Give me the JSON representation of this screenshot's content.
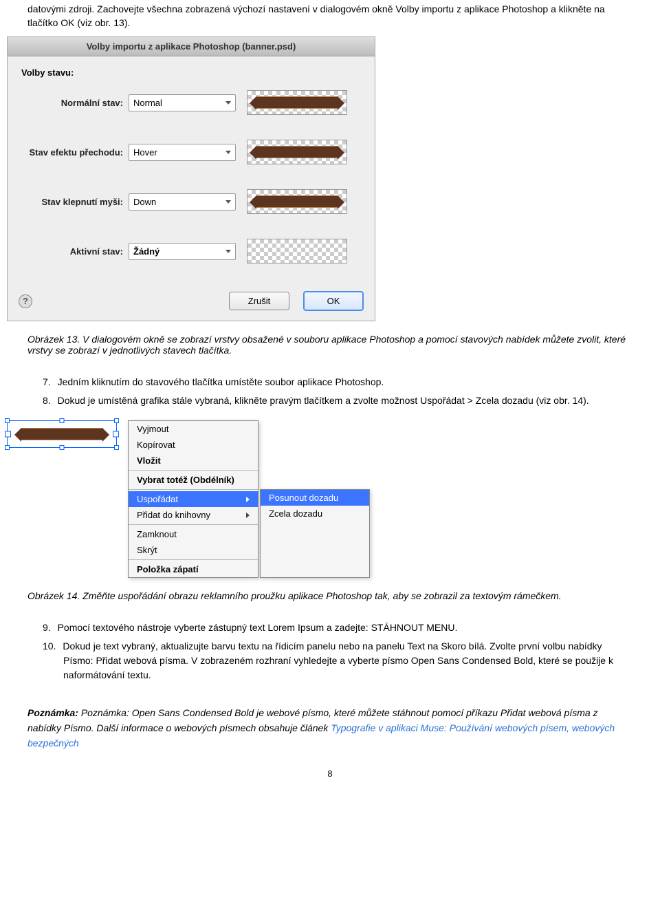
{
  "intro": "datovými zdroji. Zachovejte všechna zobrazená výchozí nastavení v dialogovém okně Volby importu z aplikace Photoshop a klikněte na tlačítko OK (viz obr. 13).",
  "dialog": {
    "title": "Volby importu z aplikace Photoshop (banner.psd)",
    "section": "Volby stavu:",
    "rows": {
      "normal": {
        "label": "Normální stav:",
        "value": "Normal"
      },
      "hover": {
        "label": "Stav efektu přechodu:",
        "value": "Hover"
      },
      "down": {
        "label": "Stav klepnutí myši:",
        "value": "Down"
      },
      "active": {
        "label": "Aktivní stav:",
        "value": "Žádný"
      }
    },
    "cancel": "Zrušit",
    "ok": "OK"
  },
  "caption13": "Obrázek 13. V dialogovém okně se zobrazí vrstvy obsažené v souboru aplikace Photoshop a pomocí stavových nabídek můžete zvolit, které vrstvy se zobrazí v jednotlivých stavech tlačítka.",
  "steps1": {
    "s7": "Jedním kliknutím do stavového tlačítka umístěte soubor aplikace Photoshop.",
    "s8": "Dokud je umístěná grafika stále vybraná, klikněte pravým tlačítkem a zvolte možnost Uspořádat > Zcela dozadu (viz obr. 14)."
  },
  "contextMenu": {
    "cut": "Vyjmout",
    "copy": "Kopírovat",
    "paste": "Vložit",
    "selectSame": "Vybrat totéž (Obdélník)",
    "arrange": "Uspořádat",
    "addLib": "Přidat do knihovny",
    "lock": "Zamknout",
    "hide": "Skrýt",
    "footerItem": "Položka zápatí",
    "sub": {
      "forward": "Posunout dozadu",
      "back": "Zcela dozadu"
    }
  },
  "caption14": "Obrázek 14. Změňte uspořádání obrazu reklamního proužku aplikace Photoshop tak, aby se zobrazil za textovým rámečkem.",
  "steps2": {
    "s9": "Pomocí textového nástroje vyberte zástupný text Lorem Ipsum a zadejte: STÁHNOUT MENU.",
    "s10": "Dokud je text vybraný, aktualizujte barvu textu na řídicím panelu nebo na panelu Text na Skoro bílá. Zvolte první volbu nabídky Písmo: Přidat webová písma. V zobrazeném rozhraní vyhledejte a vyberte písmo Open Sans Condensed Bold, které se použije k naformátování textu."
  },
  "note": {
    "prefix": "Poznámka:",
    "body1": " Poznámka: Open Sans Condensed Bold je webové písmo, které můžete stáhnout pomocí příkazu Přidat webová písma z nabídky Písmo. Další informace o webových písmech obsahuje článek ",
    "link": "Typografie v aplikaci Muse: Používání webových písem, webových bezpečných"
  },
  "pageNumber": "8"
}
